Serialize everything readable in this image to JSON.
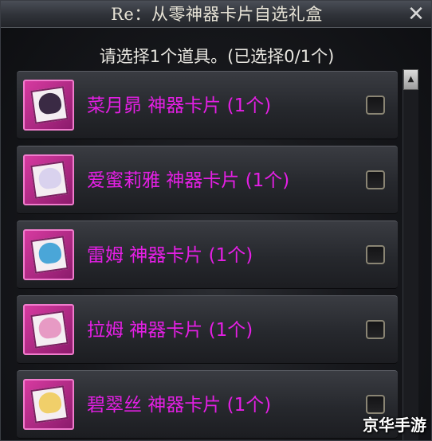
{
  "window": {
    "title": "Re：从零神器卡片自选礼盒",
    "close_glyph": "✕"
  },
  "prompt": "请选择1个道具。(已选择0/1个)",
  "items": [
    {
      "label": "菜月昴  神器卡片 (1个)",
      "checked": false,
      "icon": "card-natsuki-subaru-icon",
      "face_color": "#3a2a44"
    },
    {
      "label": "爱蜜莉雅  神器卡片 (1个)",
      "checked": false,
      "icon": "card-emilia-icon",
      "face_color": "#d9d2ee"
    },
    {
      "label": "雷姆  神器卡片 (1个)",
      "checked": false,
      "icon": "card-rem-icon",
      "face_color": "#4aa6d8"
    },
    {
      "label": "拉姆  神器卡片 (1个)",
      "checked": false,
      "icon": "card-ram-icon",
      "face_color": "#e79ac4"
    },
    {
      "label": "碧翠丝  神器卡片 (1个)",
      "checked": false,
      "icon": "card-beatrice-icon",
      "face_color": "#f0cf6a"
    }
  ],
  "scrollbar": {
    "up_glyph": "▲"
  },
  "watermark": "京华手游",
  "colors": {
    "item_label": "#e41fe4",
    "thumb_border": "#f07ccc"
  }
}
